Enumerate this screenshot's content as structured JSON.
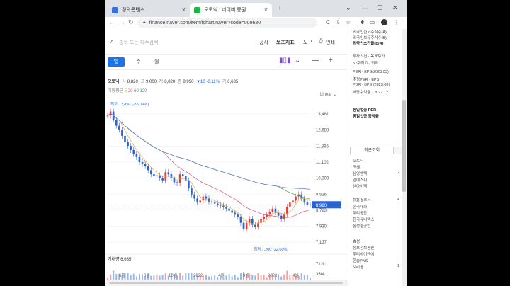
{
  "browser": {
    "tabs": [
      {
        "title": "경의콘텐츠",
        "favicon_color": "#3b6fd8",
        "active": false
      },
      {
        "title": "오토닉 : 네이버 증권",
        "favicon_color": "#22b24c",
        "active": true
      }
    ],
    "url": "finance.naver.com/item/fchart.naver?code=009680",
    "new_tab": "+",
    "back": "←",
    "forward": "→",
    "reload": "C"
  },
  "search": {
    "placeholder": "종목 또는 지수검색",
    "links": [
      "공시",
      "보조지표",
      "도구",
      "인쇄"
    ]
  },
  "period": {
    "tabs": [
      "일",
      "주",
      "월"
    ],
    "selected": "일"
  },
  "info": {
    "name": "오토닉",
    "open_label": "시",
    "open": "8,820",
    "high_label": "고",
    "high": "9,000",
    "low_label": "저",
    "low": "8,820",
    "close_label": "종",
    "close": "8,990",
    "change": "▼10 -0.11%",
    "volume_label": "거",
    "volume": "6,635"
  },
  "ma": {
    "label": "이동평균",
    "periods": [
      "5",
      "20",
      "60",
      "120"
    ],
    "colors": [
      "#e2a83a",
      "#d84b8a",
      "#4a9a4a",
      "#5a79c7"
    ]
  },
  "scale": "Linear",
  "chart_data": {
    "type": "line",
    "y_ticks": [
      "13,481",
      "12,688",
      "11,895",
      "11,102",
      "10,309",
      "9,516",
      "8,723",
      "7,930",
      "7,137"
    ],
    "x_ticks": [
      "6월",
      "8월",
      "10월",
      "2022",
      "4월",
      "8월",
      "2023",
      "4월"
    ],
    "current_price": "8,990",
    "high_annotation": "최고 13,850 (-35.09%)",
    "low_annotation": "최저 7,200 (22.60%)",
    "volume_label": "거래량",
    "volume_value": "6,635",
    "volume_ticks": [
      "712k",
      "356k"
    ],
    "candle_color_up": "#e23d3d",
    "candle_color_down": "#2c63d3",
    "close_series": [
      13400,
      13600,
      13200,
      12900,
      12700,
      12400,
      12100,
      11900,
      11700,
      11500,
      11350,
      11100,
      11000,
      10900,
      10700,
      10500,
      10400,
      10450,
      10300,
      10200,
      10600,
      10500,
      10300,
      10100,
      10050,
      10500,
      10400,
      10200,
      9800,
      9500,
      9300,
      9100,
      9200,
      9400,
      9300,
      9150,
      9100,
      9050,
      9000,
      8950,
      8900,
      8800,
      8700,
      8600,
      8500,
      8400,
      8100,
      7800,
      8100,
      8300,
      8000,
      7900,
      8100,
      8300,
      8400,
      8500,
      8650,
      8800,
      8600,
      8450,
      8300,
      8500,
      8900,
      9100,
      9200,
      9400,
      9500,
      9300,
      9100,
      9000,
      8990
    ]
  },
  "right_panel": {
    "lines_top": [
      "외국인한도주식수(A)",
      "외국인보유주식수(B)",
      "외국인소진율(B/A)"
    ],
    "lines_mid": [
      "투자의견 · 목표주가",
      "52주최고 · 최저"
    ],
    "lines_per": [
      "PER · EPS(2023.03)",
      "추정PER · EPS",
      "PBR · BPS (2023.03)",
      "배당수익률 · 2022.12"
    ],
    "lines_industry": [
      "동일업종 PER",
      "동일업종 등락률"
    ],
    "recent_title": "최근조회",
    "recent": [
      "오토닉",
      "코센",
      "삼영엠텍",
      "엠에스씨",
      "엠아이텍"
    ],
    "recent_nums": [
      "",
      "",
      "2",
      "",
      ""
    ],
    "group2": [
      "한화솔루션",
      "한국내화",
      "우리종합",
      "한국유니텍스",
      "삼성중공업"
    ],
    "group2_nums": [
      "4",
      "",
      "",
      "",
      ""
    ],
    "group3": [
      "효성",
      "성호정보통신",
      "우리아이엔에",
      "한솔PNS",
      "오리콤"
    ],
    "group3_nums": [
      "",
      "",
      "",
      "",
      "1"
    ]
  }
}
